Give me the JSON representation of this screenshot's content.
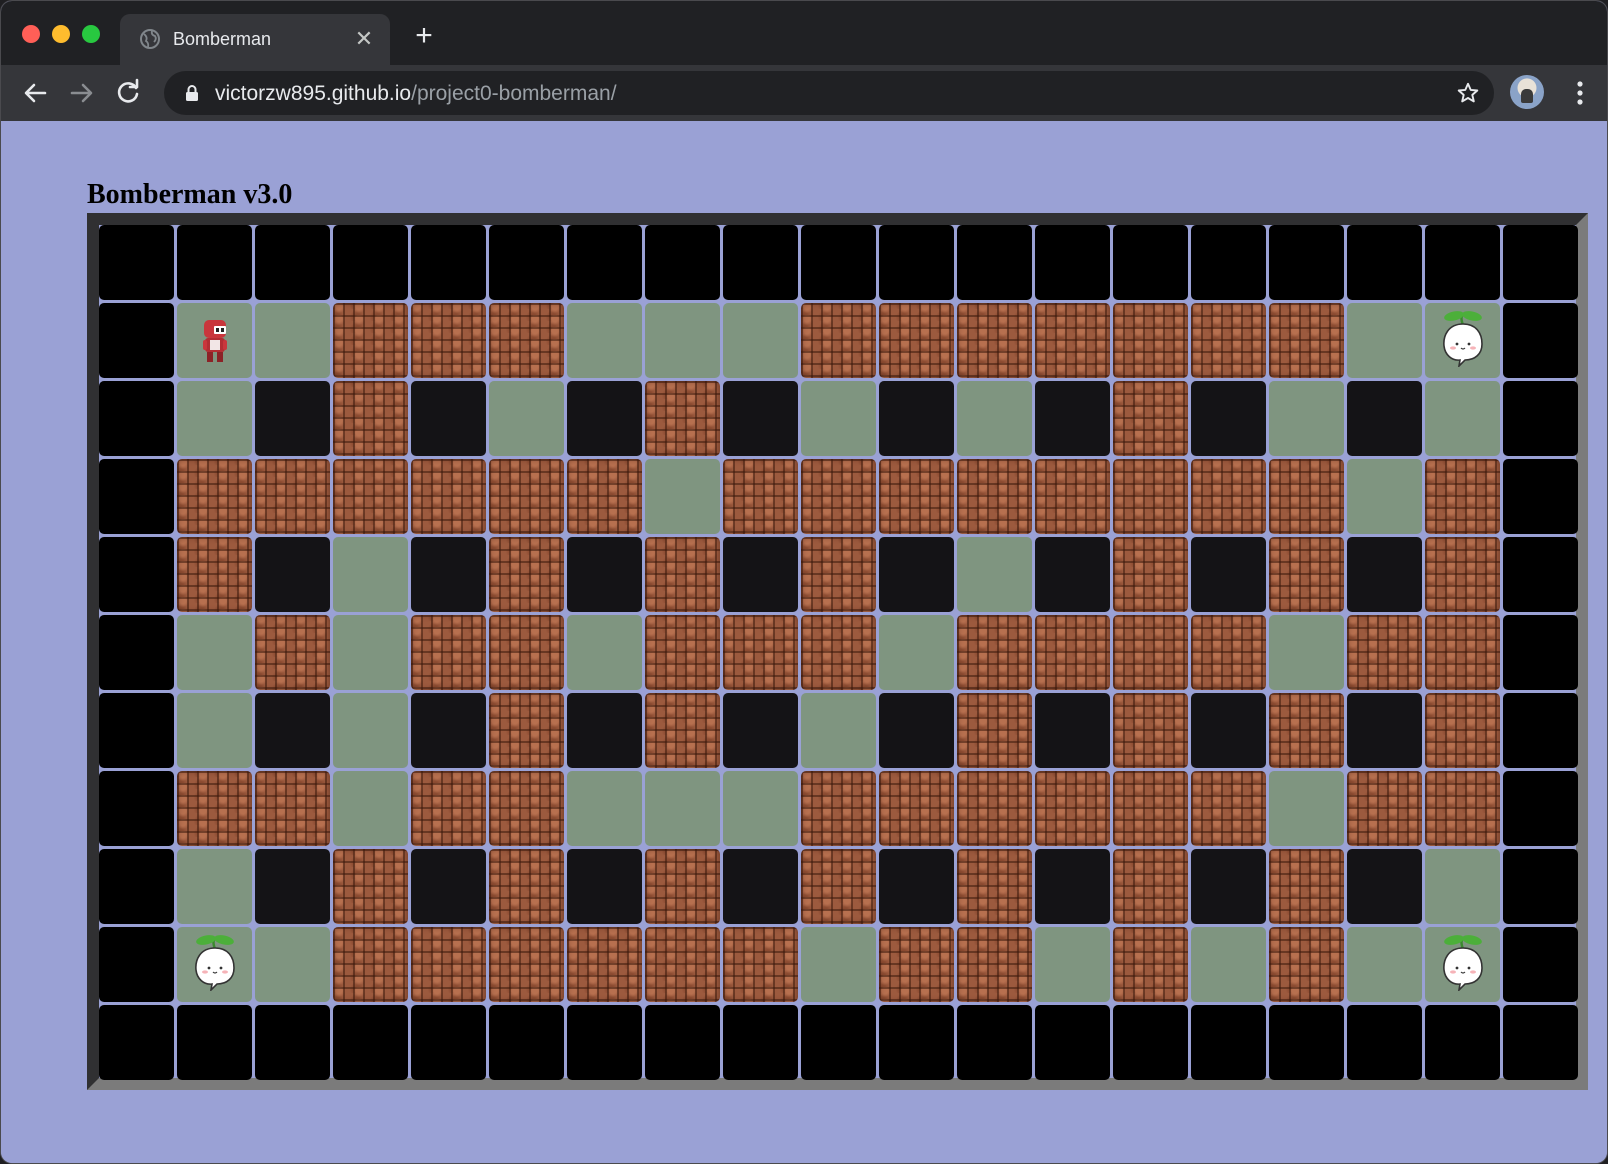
{
  "browser": {
    "tab_title": "Bomberman",
    "url_host": "victorzw895.github.io",
    "url_path": "/project0-bomberman/"
  },
  "page": {
    "heading": "Bomberman v3.0",
    "background_color": "#9aa1d5"
  },
  "board": {
    "rows": 11,
    "cols": 19,
    "legend": {
      "W": "outer wall",
      "P": "indestructible pillar",
      ".": "floor",
      "B": "brick (destructible)",
      "H": "player",
      "E": "enemy sprout"
    },
    "grid": [
      "WWWWWWWWWWWWWWWWWWW",
      "WH.BBB...BBBBBBB.EW",
      "W.PBP.PBP.P.PBP.P.W",
      "WBBBBBB.BBBBBBBB.BW",
      "WBP.PBPBPBP.PBPBPBW",
      "W.B.BB.BBB.BBBB.BBW",
      "W.P.PBPBP.PBPBPBPBW",
      "WBB.BB...BBBBBB.BBW",
      "W.PBPBPBPBPBPBPBP.W",
      "WE.BBBBBB.BB.B.B.EW",
      "WWWWWWWWWWWWWWWWWWW"
    ]
  }
}
